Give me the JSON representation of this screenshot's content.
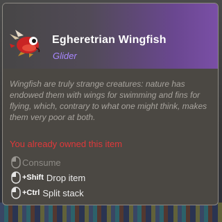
{
  "item": {
    "name": "Egheretrian Wingfish",
    "category": "Glider",
    "description": "Wingfish are truly strange creatures: nature has endowed them with wings for swimming and fins for flying, which, contrary to what one might think, makes them very poor at both.",
    "owned_notice": "You already owned this item",
    "icon": "wingfish-icon"
  },
  "actions": [
    {
      "key": "",
      "label": "Consume",
      "enabled": false,
      "icon": "mouse-left-icon"
    },
    {
      "key": "+Shift",
      "label": "Drop item",
      "enabled": true,
      "icon": "mouse-left-icon"
    },
    {
      "key": "+Ctrl",
      "label": "Split stack",
      "enabled": true,
      "icon": "mouse-left-icon"
    }
  ],
  "colors": {
    "tooltip_bg": "#4b4843",
    "header_accent": "#7a4fa6",
    "subtitle": "#a887ff",
    "warning": "#e0383a"
  }
}
